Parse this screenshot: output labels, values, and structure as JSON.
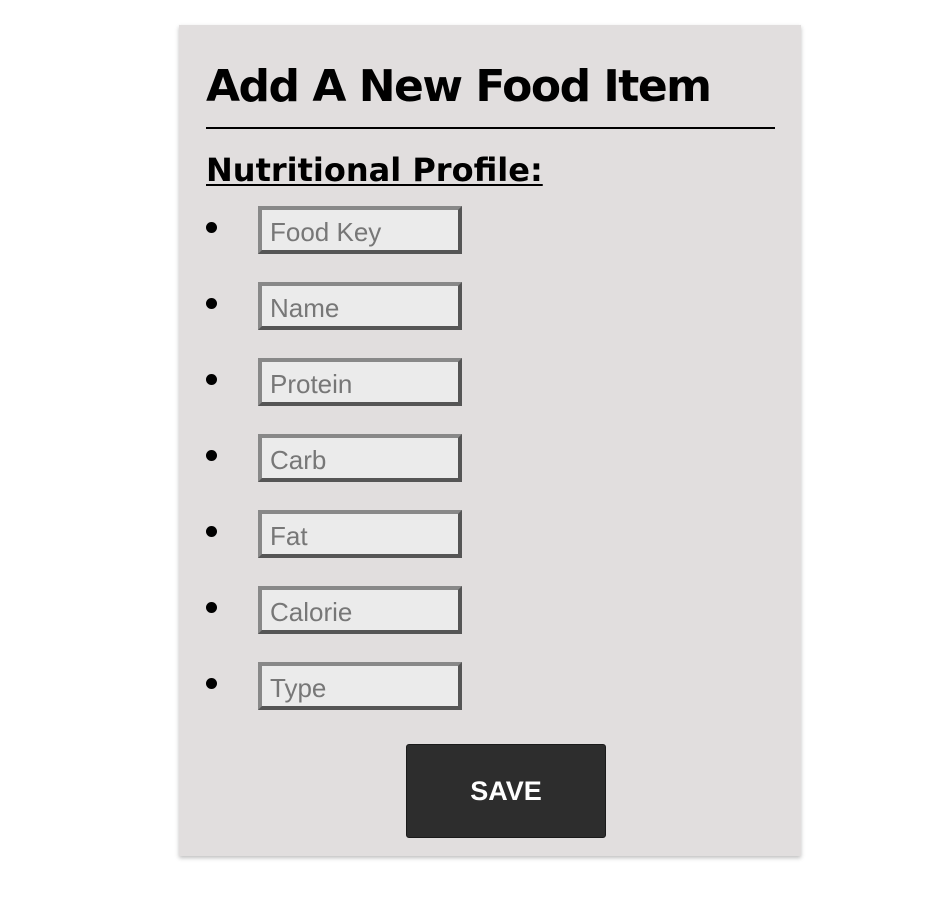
{
  "form": {
    "title": "Add A New Food Item",
    "subtitle": "Nutritional Profile:",
    "fields": [
      {
        "placeholder": "Food Key",
        "value": ""
      },
      {
        "placeholder": "Name",
        "value": ""
      },
      {
        "placeholder": "Protein",
        "value": ""
      },
      {
        "placeholder": "Carb",
        "value": ""
      },
      {
        "placeholder": "Fat",
        "value": ""
      },
      {
        "placeholder": "Calorie",
        "value": ""
      },
      {
        "placeholder": "Type",
        "value": ""
      }
    ],
    "save_label": "SAVE"
  },
  "colors": {
    "page_background": "#ffffff",
    "card_background": "#e1dede",
    "input_background": "#ebebeb",
    "button_background": "#2d2d2d",
    "button_text": "#ffffff"
  }
}
